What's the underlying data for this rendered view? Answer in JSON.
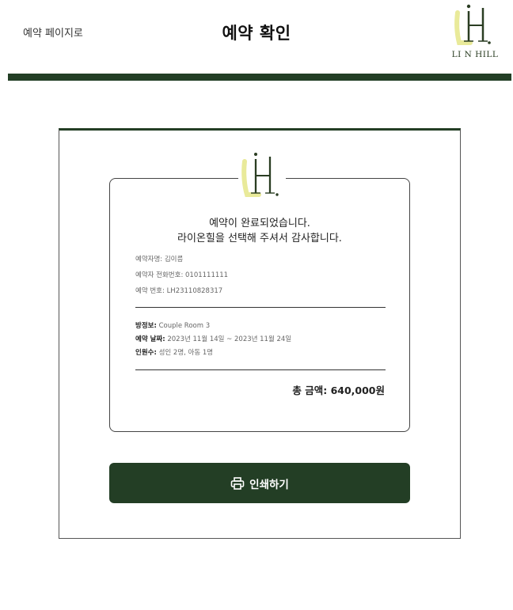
{
  "header": {
    "back_link": "예약 페이지로",
    "title": "예약 확인",
    "brand": "LI N HILL"
  },
  "receipt": {
    "message_line1": "예약이 완료되었습니다.",
    "message_line2": "라이온힐을 선택해 주셔서 감사합니다.",
    "reserver_name_label": "예약자명:",
    "reserver_name": "김이름",
    "reserver_phone_label": "예약자 전화번호:",
    "reserver_phone": "0101111111",
    "reservation_no_label": "예약 번호:",
    "reservation_no": "LH23110828317",
    "room_label": "방정보:",
    "room": "Couple Room 3",
    "dates_label": "예약 날짜:",
    "dates": "2023년 11월 14일 ~ 2023년 11월 24일",
    "guests_label": "인원수:",
    "guests": "성인 2명, 아동 1명",
    "total_label": "총 금액:",
    "total": "640,000원"
  },
  "actions": {
    "print_label": "인쇄하기"
  },
  "colors": {
    "brand_green": "#233e25",
    "logo_yellow": "#e9ea9a",
    "logo_dark": "#2a3d22"
  }
}
